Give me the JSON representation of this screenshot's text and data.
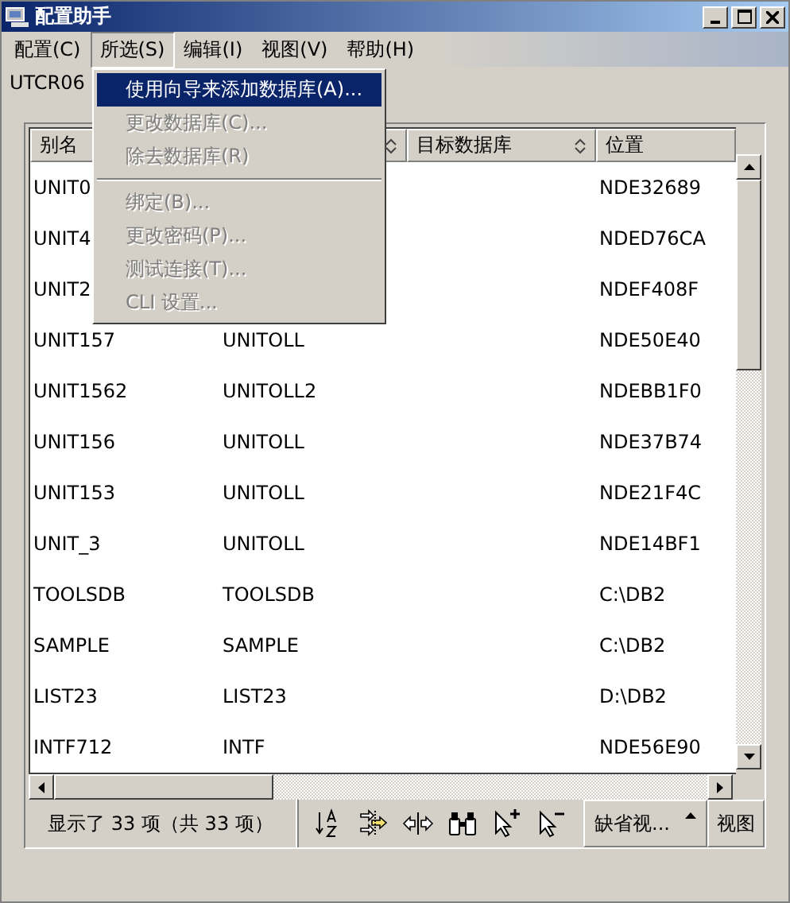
{
  "window": {
    "title": "配置助手"
  },
  "menu_bar": [
    {
      "label": "配置(C)",
      "selected": false
    },
    {
      "label": "所选(S)",
      "selected": true
    },
    {
      "label": "编辑(I)",
      "selected": false
    },
    {
      "label": "视图(V)",
      "selected": false
    },
    {
      "label": "帮助(H)",
      "selected": false
    }
  ],
  "instance_label": "UTCR06",
  "dropdown_menu": [
    {
      "kind": "item",
      "label": "使用向导来添加数据库(A)...",
      "disabled": false,
      "selected": true
    },
    {
      "kind": "item",
      "label": "更改数据库(C)...",
      "disabled": true,
      "selected": false
    },
    {
      "kind": "item",
      "label": "除去数据库(R)",
      "disabled": true,
      "selected": false
    },
    {
      "kind": "separator"
    },
    {
      "kind": "item",
      "label": "绑定(B)...",
      "disabled": true,
      "selected": false
    },
    {
      "kind": "item",
      "label": "更改密码(P)...",
      "disabled": true,
      "selected": false
    },
    {
      "kind": "item",
      "label": "测试连接(T)...",
      "disabled": true,
      "selected": false
    },
    {
      "kind": "item",
      "label": "CLI 设置...",
      "disabled": true,
      "selected": false
    }
  ],
  "table": {
    "columns": [
      "别名",
      "",
      "目标数据库",
      "位置"
    ],
    "rows": [
      [
        "UNIT0",
        "",
        "",
        "NDE32689"
      ],
      [
        "UNIT4",
        "",
        "",
        "NDED76CA"
      ],
      [
        "UNIT2",
        "",
        "",
        "NDEF408F"
      ],
      [
        "UNIT157",
        "UNITOLL",
        "",
        "NDE50E40"
      ],
      [
        "UNIT1562",
        "UNITOLL2",
        "",
        "NDEBB1F0"
      ],
      [
        "UNIT156",
        "UNITOLL",
        "",
        "NDE37B74"
      ],
      [
        "UNIT153",
        "UNITOLL",
        "",
        "NDE21F4C"
      ],
      [
        "UNIT_3",
        "UNITOLL",
        "",
        "NDE14BF1"
      ],
      [
        "TOOLSDB",
        "TOOLSDB",
        "",
        "C:\\DB2"
      ],
      [
        "SAMPLE",
        "SAMPLE",
        "",
        "C:\\DB2"
      ],
      [
        "LIST23",
        "LIST23",
        "",
        "D:\\DB2"
      ],
      [
        "INTF712",
        "INTF",
        "",
        "NDE56E90"
      ]
    ]
  },
  "status_bar": {
    "count": "显示了 33 项（共 33 项）",
    "view_selector": "缺省视...",
    "view_button": "视图"
  }
}
